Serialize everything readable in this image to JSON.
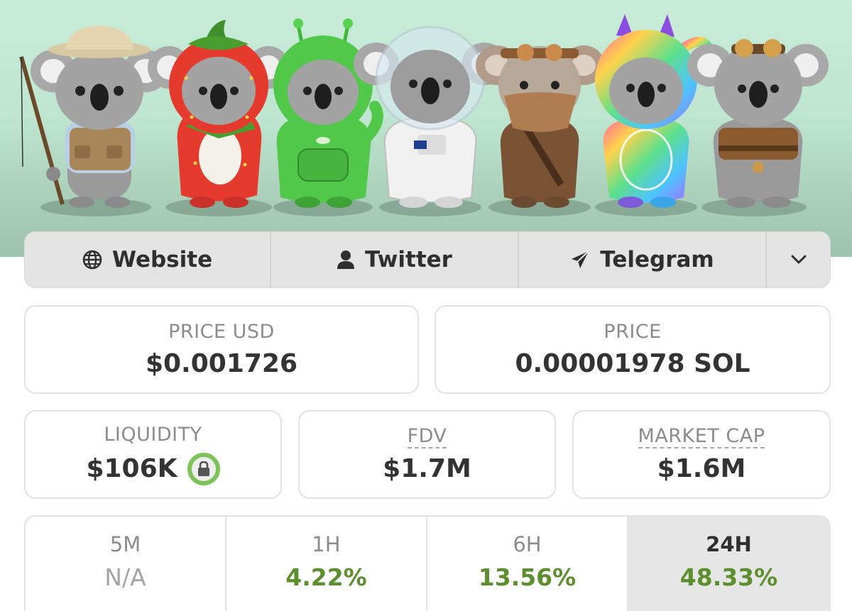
{
  "links": {
    "website": {
      "label": "Website",
      "icon": "globe-icon"
    },
    "twitter": {
      "label": "Twitter",
      "icon": "user-icon"
    },
    "telegram": {
      "label": "Telegram",
      "icon": "paper-plane-icon"
    },
    "more": {
      "icon": "chevron-down-icon"
    }
  },
  "stats": {
    "price_usd": {
      "label": "PRICE USD",
      "value": "$0.001726"
    },
    "price_native": {
      "label": "PRICE",
      "value": "0.00001978 SOL"
    },
    "liquidity": {
      "label": "LIQUIDITY",
      "value": "$106K",
      "icon": "lock-icon"
    },
    "fdv": {
      "label": "FDV",
      "value": "$1.7M"
    },
    "market_cap": {
      "label": "MARKET CAP",
      "value": "$1.6M"
    }
  },
  "changes": [
    {
      "label": "5M",
      "value": "N/A"
    },
    {
      "label": "1H",
      "value": "4.22%"
    },
    {
      "label": "6H",
      "value": "13.56%"
    },
    {
      "label": "24H",
      "value": "48.33%"
    }
  ],
  "colors": {
    "positive": "#5d8f2e",
    "lock_ring": "#7cc45a",
    "banner_bg": "#c8ecd8"
  }
}
